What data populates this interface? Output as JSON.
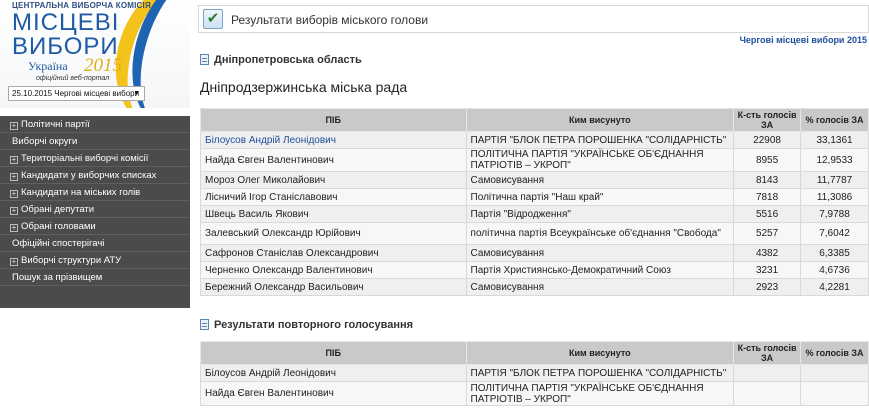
{
  "logo": {
    "org": "ЦЕНТРАЛЬНА ВИБОРЧА КОМІСІЯ",
    "word1": "МІСЦЕВІ",
    "word2": "ВИБОРИ",
    "country": "Україна",
    "year": "2015",
    "portal": "офіційний веб-портал"
  },
  "date_select": {
    "value": "25.10.2015 Чергові місцеві вибори",
    "caret": "▼"
  },
  "nav": {
    "items": [
      {
        "label": "Політичні партії",
        "expand": "+"
      },
      {
        "label": "Виборчі округи",
        "expand": ""
      },
      {
        "label": "Територіальні виборчі комісії",
        "expand": "+"
      },
      {
        "label": "Кандидати у виборчих списках",
        "expand": "+"
      },
      {
        "label": "Кандидати на міських голів",
        "expand": "+"
      },
      {
        "label": "Обрані депутати",
        "expand": "+"
      },
      {
        "label": "Обрані головами",
        "expand": "+"
      },
      {
        "label": "Офіційні спостерігачі",
        "expand": ""
      },
      {
        "label": "Виборчі структури АТУ",
        "expand": "+"
      },
      {
        "label": "Пошук за прізвищем",
        "expand": ""
      }
    ]
  },
  "page_title": "Результати виборів міського голови",
  "page_icon": "checkmark-icon",
  "regular_elections_link": "Чергові місцеві вибори 2015",
  "region": "Дніпропетровська область",
  "council": "Дніпродзержинська міська рада",
  "table_headers": {
    "name": "ПІБ",
    "nominated": "Ким висунуто",
    "votes": "К-сть голосів ЗА",
    "percent": "% голосів ЗА"
  },
  "results": [
    {
      "name": "Білоусов Андрій Леонідович",
      "nominated": "ПАРТІЯ \"БЛОК ПЕТРА ПОРОШЕНКА \"СОЛІДАРНІСТЬ\"",
      "votes": "22908",
      "percent": "33,1361"
    },
    {
      "name": "Найда Євген Валентинович",
      "nominated": "ПОЛІТИЧНА ПАРТІЯ \"УКРАЇНСЬКЕ ОБ'ЄДНАННЯ ПАТРІОТІВ – УКРОП\"",
      "votes": "8955",
      "percent": "12,9533"
    },
    {
      "name": "Мороз Олег Миколайович",
      "nominated": "Самовисування",
      "votes": "8143",
      "percent": "11,7787"
    },
    {
      "name": "Лісничий Ігор Станіславович",
      "nominated": "Політична партія \"Наш край\"",
      "votes": "7818",
      "percent": "11,3086"
    },
    {
      "name": "Швець Василь Якович",
      "nominated": "Партія \"Відродження\"",
      "votes": "5516",
      "percent": "7,9788"
    },
    {
      "name": "Залевський Олександр Юрійович",
      "nominated": "політична партія Всеукраїнське об'єднання \"Свобода\"",
      "votes": "5257",
      "percent": "7,6042"
    },
    {
      "name": "Сафронов Станіслав Олександрович",
      "nominated": "Самовисування",
      "votes": "4382",
      "percent": "6,3385"
    },
    {
      "name": "Черненко Олександр Валентинович",
      "nominated": "Партія Християнсько-Демократичний Союз",
      "votes": "3231",
      "percent": "4,6736"
    },
    {
      "name": "Бережний Олександр Васильович",
      "nominated": "Самовисування",
      "votes": "2923",
      "percent": "4,2281"
    }
  ],
  "repeat_title": "Результати повторного голосування",
  "repeat_results": [
    {
      "name": "Білоусов Андрій Леонідович",
      "nominated": "ПАРТІЯ \"БЛОК ПЕТРА ПОРОШЕНКА \"СОЛІДАРНІСТЬ\"",
      "votes": "",
      "percent": ""
    },
    {
      "name": "Найда Євген Валентинович",
      "nominated": "ПОЛІТИЧНА ПАРТІЯ \"УКРАЇНСЬКЕ ОБ'ЄДНАННЯ ПАТРІОТІВ – УКРОП\"",
      "votes": "",
      "percent": ""
    }
  ]
}
